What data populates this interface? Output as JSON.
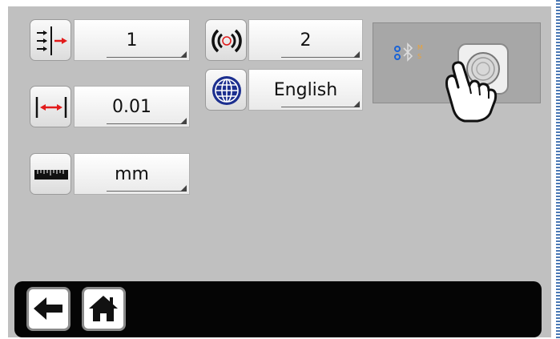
{
  "settings": {
    "direction_value": "1",
    "resolution_value": "0.01",
    "unit_value": "mm",
    "signal_value": "2",
    "language_value": "English"
  },
  "bluetooth_panel": {
    "label_top": "M",
    "label_bottom": "S"
  },
  "colors": {
    "screen_bg": "#c0c0c0",
    "accent_red": "#e21b1b",
    "accent_blue": "#1c2f8f",
    "bar_bg": "#050505"
  },
  "icons": {
    "direction": "direction-arrows-icon",
    "resolution": "resolution-arrows-icon",
    "unit": "ruler-icon",
    "signal": "signal-waves-icon",
    "language": "globe-icon",
    "touch": "touch-hand-icon",
    "bluetooth": "bluetooth-icon",
    "back": "back-arrow-icon",
    "home": "home-icon"
  }
}
